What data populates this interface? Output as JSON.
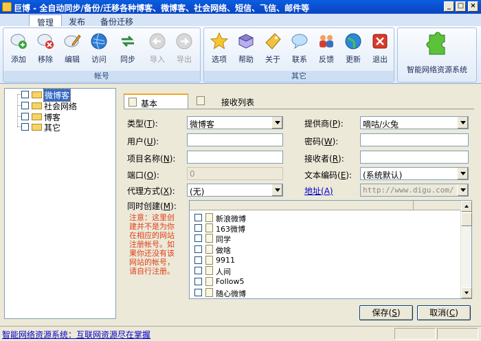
{
  "window": {
    "title": "巨博 - 全自动同步/备份/迁移各种博客、微博客、社会网络、短信、飞信、邮件等",
    "controls": [
      "_",
      "□",
      "×"
    ]
  },
  "ribbon": {
    "tabs": [
      "管理",
      "发布",
      "备份迁移"
    ],
    "active_tab": "管理",
    "groups": [
      {
        "label": "帐号",
        "buttons": [
          {
            "label": "添加",
            "icon": "add-user-icon"
          },
          {
            "label": "移除",
            "icon": "remove-user-icon"
          },
          {
            "label": "编辑",
            "icon": "edit-user-icon"
          },
          {
            "label": "访问",
            "icon": "globe-icon"
          },
          {
            "label": "同步",
            "icon": "sync-icon"
          },
          {
            "label": "导入",
            "icon": "import-icon"
          },
          {
            "label": "导出",
            "icon": "export-icon"
          }
        ]
      },
      {
        "label": "其它",
        "buttons": [
          {
            "label": "选项",
            "icon": "star-icon"
          },
          {
            "label": "帮助",
            "icon": "book-icon"
          },
          {
            "label": "关于",
            "icon": "tag-icon"
          },
          {
            "label": "联系",
            "icon": "chat-icon"
          },
          {
            "label": "反馈",
            "icon": "people-icon"
          },
          {
            "label": "更新",
            "icon": "update-globe-icon"
          },
          {
            "label": "退出",
            "icon": "exit-icon"
          }
        ]
      }
    ],
    "brand": {
      "label": "智能网络资源系统",
      "icon": "puzzle-icon"
    }
  },
  "tree": {
    "items": [
      {
        "label": "微博客",
        "selected": true
      },
      {
        "label": "社会网络",
        "selected": false
      },
      {
        "label": "博客",
        "selected": false
      },
      {
        "label": "其它",
        "selected": false
      }
    ]
  },
  "content_tabs": [
    "基本",
    "接收列表"
  ],
  "form": {
    "type": {
      "label": "类型",
      "hotkey": "T",
      "value": "微博客"
    },
    "provider": {
      "label": "提供商",
      "hotkey": "P",
      "value": "嘀咕/火兔"
    },
    "user": {
      "label": "用户",
      "hotkey": "U",
      "value": ""
    },
    "password": {
      "label": "密码",
      "hotkey": "W",
      "value": ""
    },
    "project_name": {
      "label": "项目名称",
      "hotkey": "N",
      "value": ""
    },
    "receiver": {
      "label": "接收者",
      "hotkey": "R",
      "value": ""
    },
    "port": {
      "label": "端口",
      "hotkey": "O",
      "value": "0"
    },
    "encoding": {
      "label": "文本编码",
      "hotkey": "E",
      "value": "(系统默认)"
    },
    "proxy": {
      "label": "代理方式",
      "hotkey": "X",
      "value": "(无)"
    },
    "address": {
      "label": "地址",
      "hotkey": "A",
      "value": "http://www.digu.com/"
    },
    "simultaneous": {
      "label": "同时创建",
      "hotkey": "M"
    },
    "note": "注意：这里创建并不是为你在相应的网站注册帐号。如果你还没有该网站的帐号，请自行注册。"
  },
  "site_list": [
    "新浪微博",
    "163微博",
    "同学",
    "做啥",
    "9911",
    "人间",
    "Follow5",
    "随心微博"
  ],
  "buttons": {
    "save": {
      "label": "保存",
      "hotkey": "S"
    },
    "cancel": {
      "label": "取消",
      "hotkey": "C"
    }
  },
  "status": {
    "text": "智能网络资源系统：互联网资源尽在掌握"
  }
}
